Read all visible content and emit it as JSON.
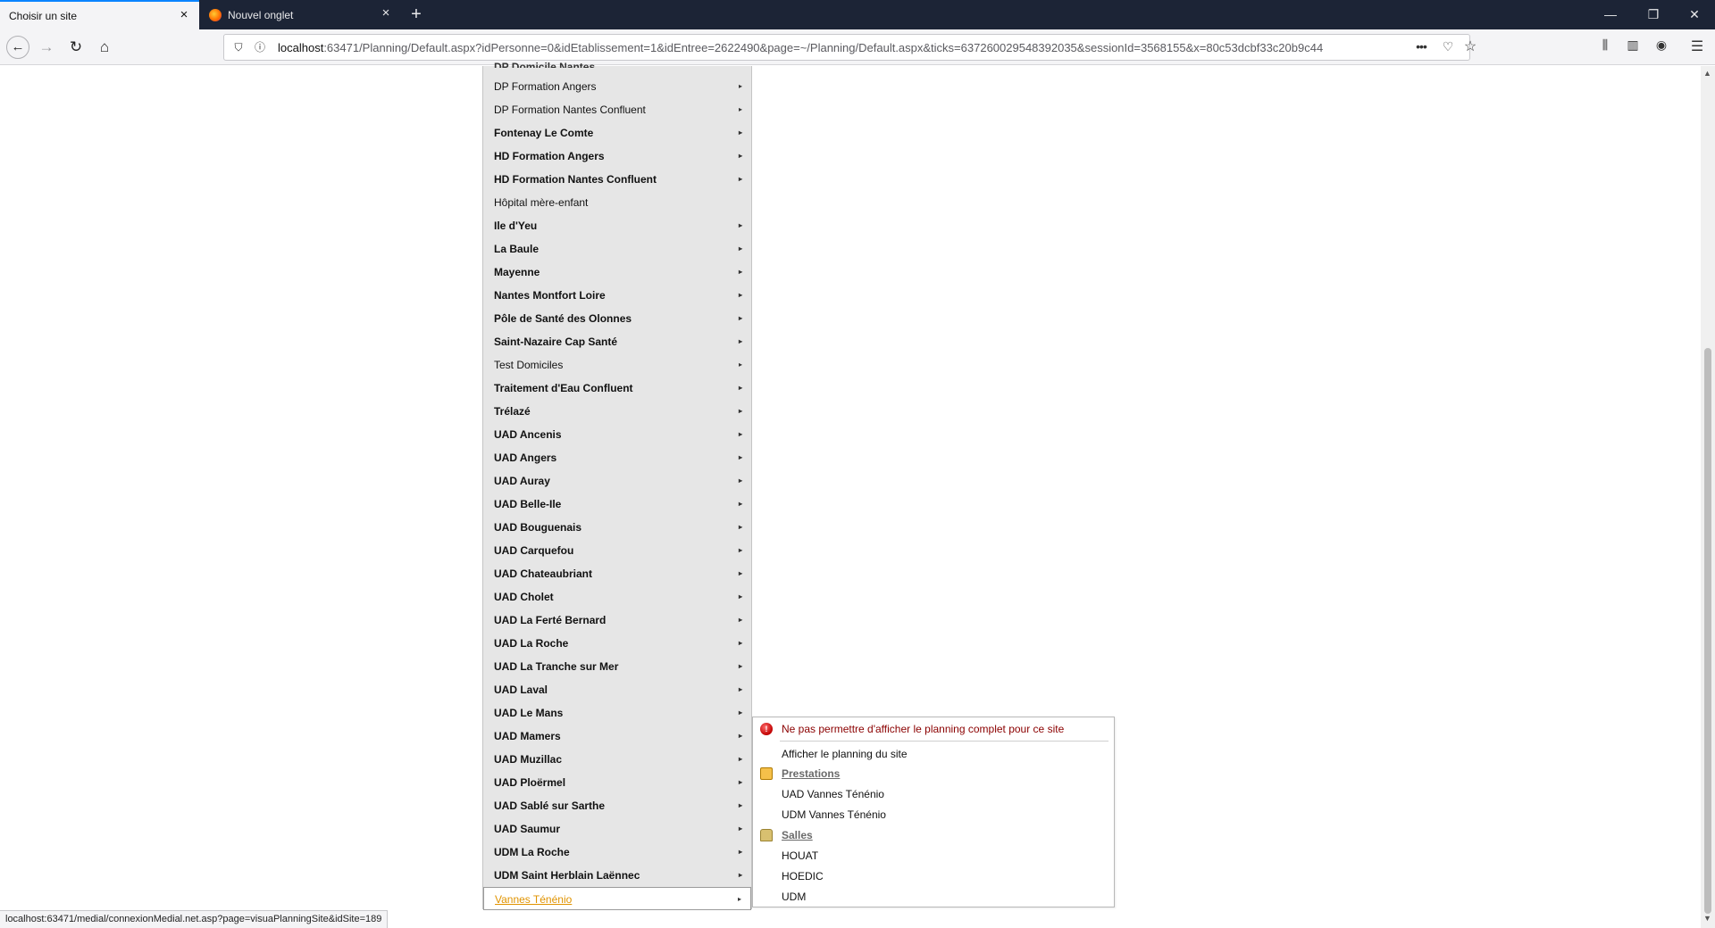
{
  "browser": {
    "tabs": [
      {
        "label": "Choisir un site"
      },
      {
        "label": "Nouvel onglet"
      }
    ],
    "url_host": "localhost",
    "url_rest": ":63471/Planning/Default.aspx?idPersonne=0&idEtablissement=1&idEntree=2622490&page=~/Planning/Default.aspx&ticks=637260029548392035&sessionId=3568155&x=80c53dcbf33c20b9c44",
    "status_url": "localhost:63471/medial/connexionMedial.net.asp?page=visuaPlanningSite&idSite=189",
    "icons": {
      "tab_close": "×",
      "new_tab": "+",
      "minimize": "—",
      "restore": "❐",
      "close": "✕",
      "back": "←",
      "forward": "→",
      "reload": "↻",
      "home": "⌂",
      "shield": "⛉",
      "info": "ⓘ",
      "more": "•••",
      "pocket": "♡",
      "bookmark": "☆",
      "library": "⫼",
      "sidebar": "▥",
      "account": "◉",
      "menu": "☰"
    }
  },
  "site_menu": {
    "clipped_top_label": "DP Domicile Nantes",
    "items": [
      {
        "label": "DP Formation Angers",
        "bold": false
      },
      {
        "label": "DP Formation Nantes Confluent",
        "bold": false
      },
      {
        "label": "Fontenay Le Comte",
        "bold": true
      },
      {
        "label": "HD Formation Angers",
        "bold": true
      },
      {
        "label": "HD Formation Nantes Confluent",
        "bold": true
      },
      {
        "label": "Hôpital mère-enfant",
        "bold": false,
        "no_arrow": true
      },
      {
        "label": "Ile d'Yeu",
        "bold": true
      },
      {
        "label": "La Baule",
        "bold": true
      },
      {
        "label": "Mayenne",
        "bold": true
      },
      {
        "label": "Nantes Montfort Loire",
        "bold": true
      },
      {
        "label": "Pôle de Santé des Olonnes",
        "bold": true
      },
      {
        "label": "Saint-Nazaire Cap Santé",
        "bold": true
      },
      {
        "label": "Test Domiciles",
        "bold": false
      },
      {
        "label": "Traitement d'Eau Confluent",
        "bold": true
      },
      {
        "label": "Trélazé",
        "bold": true
      },
      {
        "label": "UAD Ancenis",
        "bold": true
      },
      {
        "label": "UAD Angers",
        "bold": true
      },
      {
        "label": "UAD Auray",
        "bold": true
      },
      {
        "label": "UAD Belle-Ile",
        "bold": true
      },
      {
        "label": "UAD Bouguenais",
        "bold": true
      },
      {
        "label": "UAD Carquefou",
        "bold": true
      },
      {
        "label": "UAD Chateaubriant",
        "bold": true
      },
      {
        "label": "UAD Cholet",
        "bold": true
      },
      {
        "label": "UAD La Ferté Bernard",
        "bold": true
      },
      {
        "label": "UAD La Roche",
        "bold": true
      },
      {
        "label": "UAD La Tranche sur Mer",
        "bold": true
      },
      {
        "label": "UAD Laval",
        "bold": true
      },
      {
        "label": "UAD Le Mans",
        "bold": true
      },
      {
        "label": "UAD Mamers",
        "bold": true
      },
      {
        "label": "UAD Muzillac",
        "bold": true
      },
      {
        "label": "UAD Ploërmel",
        "bold": true
      },
      {
        "label": "UAD Sablé sur Sarthe",
        "bold": true
      },
      {
        "label": "UAD Saumur",
        "bold": true
      },
      {
        "label": "UDM La Roche",
        "bold": true
      },
      {
        "label": "UDM Saint Herblain Laënnec",
        "bold": true
      },
      {
        "label": "Vannes Ténénio",
        "bold": false,
        "selected": true
      }
    ],
    "arrow": "▸"
  },
  "submenu": {
    "warning": "Ne pas permettre d'afficher le planning complet pour ce site",
    "show_planning": "Afficher le planning du site",
    "prestations_header": "Prestations",
    "prestations": [
      "UAD Vannes Ténénio",
      "UDM Vannes Ténénio"
    ],
    "salles_header": "Salles",
    "salles": [
      "HOUAT",
      "HOEDIC",
      "UDM"
    ]
  },
  "colors": {
    "tabbar_bg": "#1c2436",
    "menu_bg": "#e6e6e6",
    "selected_text": "#e09300",
    "warning_text": "#8b0000",
    "accent": "#0a84ff"
  }
}
